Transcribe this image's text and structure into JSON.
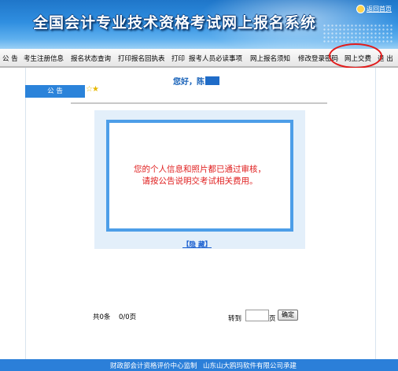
{
  "header": {
    "title": "全国会计专业技术资格考试网上报名系统",
    "home_link": "返回首页"
  },
  "nav": {
    "items": [
      "公 告",
      "考生注册信息",
      "报名状态查询",
      "打印报名回执表",
      "打印",
      "报考人员必读事项",
      "网上报名须知",
      "修改登录密码",
      "网上交费",
      "退 出"
    ]
  },
  "greeting": {
    "text": "您好，陈"
  },
  "notice_tab": {
    "label": "公    告"
  },
  "notice": {
    "message": "您的个人信息和照片都已通过审核，请按公告说明交考试相关费用。",
    "collapse_label": "【隐 藏】"
  },
  "pagination": {
    "count": "共0条",
    "pages": "0/0页",
    "goto_label": "转到",
    "goto_value": "",
    "page_suffix": "页",
    "confirm_label": "确定"
  },
  "footer": {
    "supervisor": "财政部会计资格评价中心监制",
    "developer": "山东山大鸥玛软件有限公司承建"
  },
  "colors": {
    "banner_blue": "#2f8ee0",
    "nav_highlight_circle": "#e21b1b",
    "notice_text": "#e02020",
    "footer_blue": "#2b7fd9"
  }
}
